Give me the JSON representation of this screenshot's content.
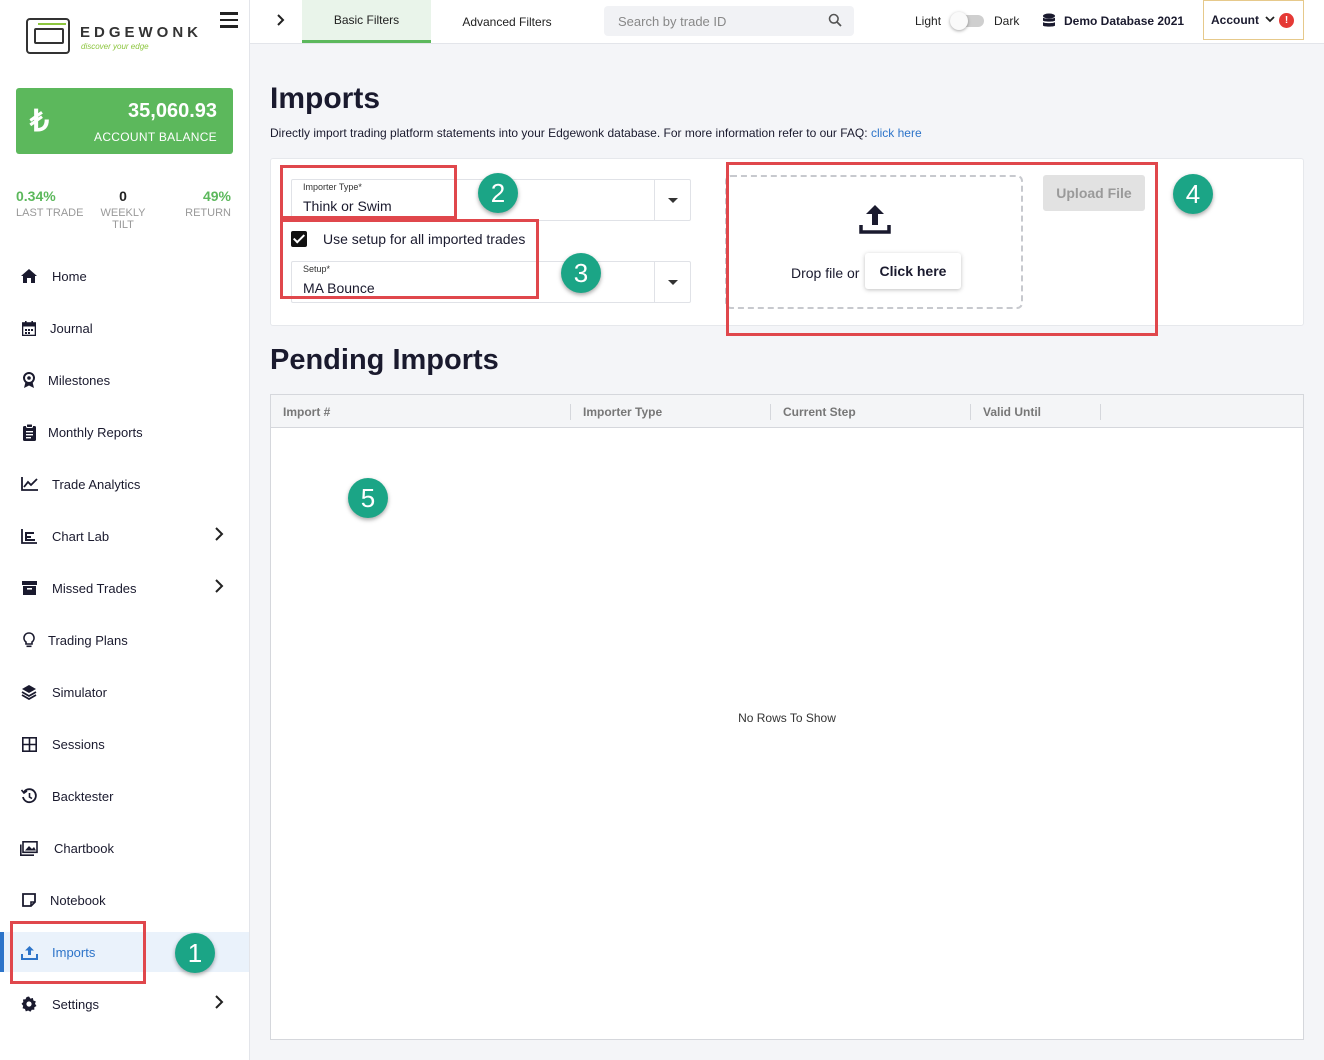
{
  "app": {
    "logo_word": "EDGEWONK",
    "logo_tagline": "discover your edge"
  },
  "account": {
    "currency_symbol": "₺",
    "balance": "35,060.93",
    "balance_label": "ACCOUNT BALANCE",
    "stats": [
      {
        "value": "0.34%",
        "label": "LAST TRADE"
      },
      {
        "value": "0",
        "label": "WEEKLY TILT"
      },
      {
        "value": "49%",
        "label": "RETURN"
      }
    ]
  },
  "nav": [
    {
      "label": "Home",
      "icon": "home-icon",
      "has_submenu": false
    },
    {
      "label": "Journal",
      "icon": "calendar-icon",
      "has_submenu": false
    },
    {
      "label": "Milestones",
      "icon": "award-icon",
      "has_submenu": false
    },
    {
      "label": "Monthly Reports",
      "icon": "clipboard-icon",
      "has_submenu": false
    },
    {
      "label": "Trade Analytics",
      "icon": "line-chart-icon",
      "has_submenu": false
    },
    {
      "label": "Chart Lab",
      "icon": "bar-chart-icon",
      "has_submenu": true
    },
    {
      "label": "Missed Trades",
      "icon": "archive-icon",
      "has_submenu": true
    },
    {
      "label": "Trading Plans",
      "icon": "lightbulb-icon",
      "has_submenu": false
    },
    {
      "label": "Simulator",
      "icon": "layers-icon",
      "has_submenu": false
    },
    {
      "label": "Sessions",
      "icon": "grid-icon",
      "has_submenu": false
    },
    {
      "label": "Backtester",
      "icon": "history-icon",
      "has_submenu": false
    },
    {
      "label": "Chartbook",
      "icon": "images-icon",
      "has_submenu": false
    },
    {
      "label": "Notebook",
      "icon": "note-icon",
      "has_submenu": false
    },
    {
      "label": "Imports",
      "icon": "upload-icon",
      "has_submenu": false,
      "active": true
    },
    {
      "label": "Settings",
      "icon": "gear-icon",
      "has_submenu": true
    }
  ],
  "topbar": {
    "tabs": [
      "Basic Filters",
      "Advanced Filters"
    ],
    "search_placeholder": "Search by trade ID",
    "theme_light": "Light",
    "theme_dark": "Dark",
    "database": "Demo Database 2021",
    "account_label": "Account",
    "alert_glyph": "!"
  },
  "imports": {
    "title": "Imports",
    "description": "Directly import trading platform statements into your Edgewonk database. For more information refer to our FAQ:",
    "faq_link": "click here",
    "importer_type_label": "Importer Type*",
    "importer_type_value": "Think or Swim",
    "use_setup_label": "Use setup for all imported trades",
    "use_setup_checked": true,
    "setup_label": "Setup*",
    "setup_value": "MA Bounce",
    "drop_text": "Drop file or",
    "click_here": "Click here",
    "upload_button": "Upload File"
  },
  "pending": {
    "title": "Pending Imports",
    "columns": [
      "Import #",
      "Importer Type",
      "Current Step",
      "Valid Until"
    ],
    "empty_text": "No Rows To Show"
  },
  "annotations": [
    "1",
    "2",
    "3",
    "4",
    "5"
  ],
  "colors": {
    "accent_green": "#5cb85c",
    "active_blue": "#2d74c9",
    "annotation_red": "#e0474c",
    "badge_teal": "#1ba586"
  }
}
